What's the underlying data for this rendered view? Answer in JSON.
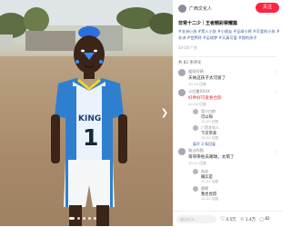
{
  "header": {
    "author": "广西文化人",
    "follow_label": "关注"
  },
  "post": {
    "title": "非常十二少｜王者精彩荣耀篇",
    "tags": "#非洲小孩 #黑人小孩 #小朋友 #足球小将 #可爱的小孩 #非洲 #世界杯 #足球梦 #天真可爱 #我的孩子",
    "meta": "10-18 广东"
  },
  "comments_total": "共 82 条评论",
  "comments": [
    {
      "name": "暖阳阿姨",
      "text": "天呐这孩子太可爱了",
      "sub": "10-19 回复",
      "red": false
    },
    {
      "name": "小红薯XXXX",
      "text": "好乖好可爱要合影",
      "sub": "10-20 回复",
      "red": true
    }
  ],
  "replies": [
    {
      "name": "是小白鹤",
      "text": "可以呀",
      "sub": "10-20 回复"
    },
    {
      "name": "广西文化人",
      "text": "下次带来",
      "sub": "10-20 回复"
    }
  ],
  "replies_expand": "展开 3 条回复",
  "comments_2": [
    {
      "name": "路过的猫",
      "text": "哥哥带他去踢球，太萌了",
      "sub": "10-21 回复"
    }
  ],
  "replies_2": [
    {
      "name": "苗苗",
      "text": "确实是",
      "sub": "10-21 回复"
    },
    {
      "name": "晨曦",
      "text": "我也觉得",
      "sub": "10-22 回复"
    }
  ],
  "bottom": {
    "input_placeholder": "说点什么...",
    "likes": "4.5万",
    "collects": "1.4万",
    "comments": "82"
  },
  "photo": {
    "jersey_text": "KING",
    "jersey_number": "1"
  },
  "colors": {
    "accent": "#ff2442",
    "link": "#3a5c9a",
    "jersey_blue": "#2f7fd0",
    "hair_blue": "#2a6fe0"
  }
}
